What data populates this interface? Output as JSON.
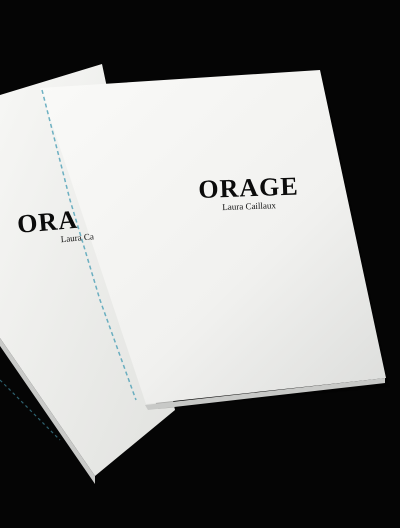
{
  "booklets": {
    "back": {
      "title": "ORA",
      "subtitle": "Laura Ca"
    },
    "front": {
      "title": "ORAGE",
      "subtitle": "Laura Caillaux"
    }
  },
  "colors": {
    "background": "#050505",
    "paper": "#f4f4f2",
    "paper_shadow": "#d9dad8",
    "stitching": "#4a9fb5"
  }
}
